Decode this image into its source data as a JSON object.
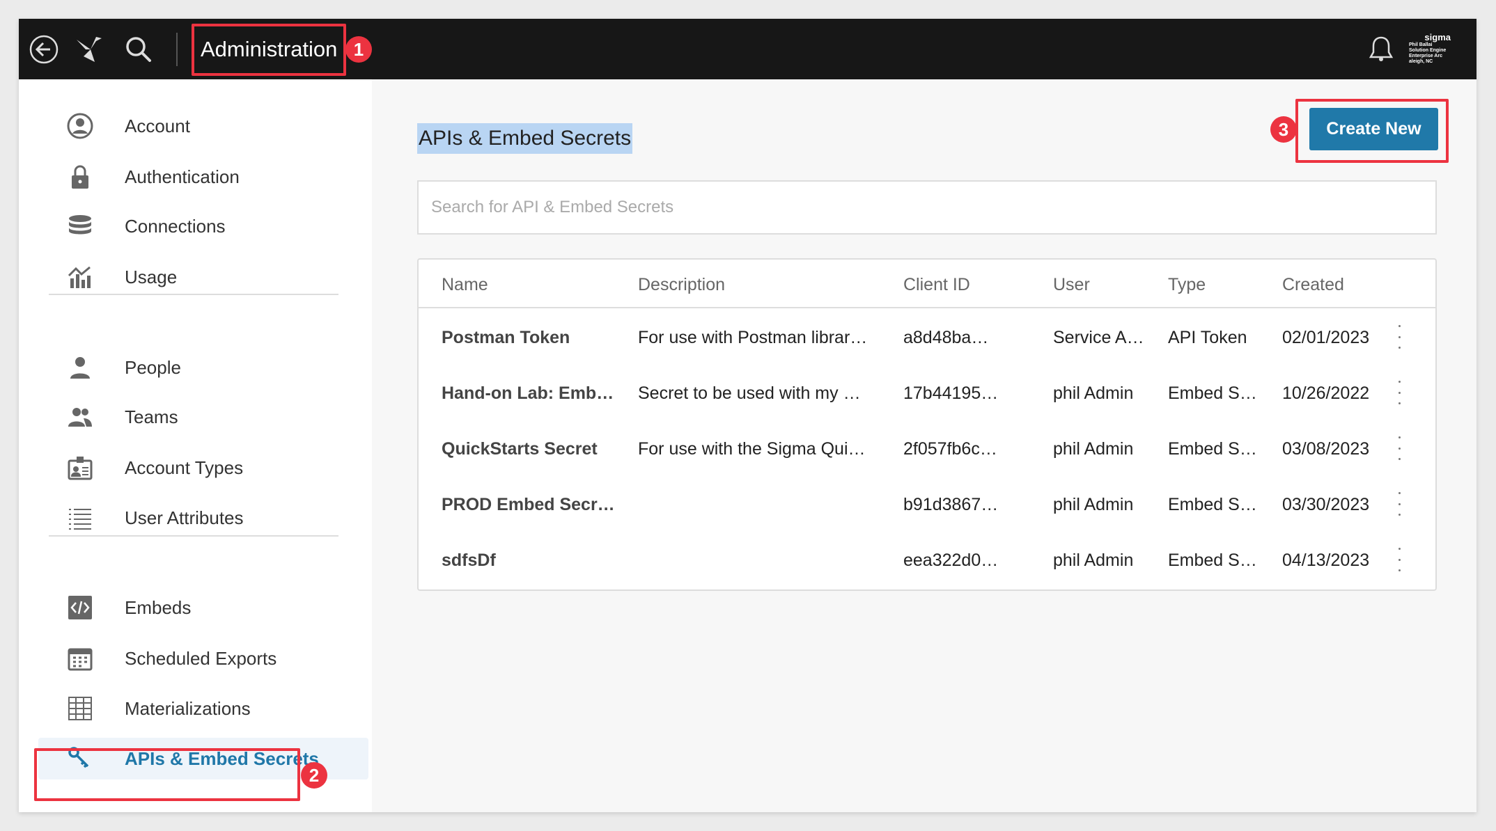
{
  "topbar": {
    "title": "Administration",
    "avatar_logo": "sigma",
    "avatar_lines": [
      "Phil Ballai",
      "Solution Engine",
      "Enterprise Arc",
      "aleigh, NC"
    ]
  },
  "sidebar": {
    "groups": [
      [
        {
          "label": "Account",
          "icon": "user-circle-icon"
        },
        {
          "label": "Authentication",
          "icon": "lock-icon"
        },
        {
          "label": "Connections",
          "icon": "database-icon"
        },
        {
          "label": "Usage",
          "icon": "usage-chart-icon"
        }
      ],
      [
        {
          "label": "People",
          "icon": "person-icon"
        },
        {
          "label": "Teams",
          "icon": "team-icon"
        },
        {
          "label": "Account Types",
          "icon": "id-badge-icon"
        },
        {
          "label": "User Attributes",
          "icon": "list-icon"
        }
      ],
      [
        {
          "label": "Embeds",
          "icon": "code-icon"
        },
        {
          "label": "Scheduled Exports",
          "icon": "calendar-icon"
        },
        {
          "label": "Materializations",
          "icon": "grid-table-icon"
        },
        {
          "label": "APIs & Embed Secrets",
          "icon": "key-icon",
          "selected": true
        }
      ]
    ]
  },
  "main": {
    "title": "APIs & Embed Secrets",
    "create_label": "Create New",
    "search_placeholder": "Search for API & Embed Secrets",
    "columns": [
      "Name",
      "Description",
      "Client ID",
      "User",
      "Type",
      "Created"
    ],
    "rows": [
      [
        "Postman Token",
        "For use with Postman librar…",
        "a8d48ba…",
        "Service A…",
        "API Token",
        "02/01/2023"
      ],
      [
        "Hand-on Lab: Emb…",
        "Secret to be used with my …",
        "17b44195…",
        "phil Admin",
        "Embed S…",
        "10/26/2022"
      ],
      [
        "QuickStarts Secret",
        "For use with the Sigma Qui…",
        "2f057fb6c…",
        "phil Admin",
        "Embed S…",
        "03/08/2023"
      ],
      [
        "PROD Embed Secr…",
        "",
        "b91d3867…",
        "phil Admin",
        "Embed S…",
        "03/30/2023"
      ],
      [
        "sdfsDf",
        "",
        "eea322d0…",
        "phil Admin",
        "Embed S…",
        "04/13/2023"
      ]
    ]
  },
  "annotations": [
    "1",
    "2",
    "3"
  ],
  "colors": {
    "accent": "#2079a9",
    "annotation": "#ec3340",
    "topbar": "#171717",
    "selection": "#b9d5f3"
  }
}
